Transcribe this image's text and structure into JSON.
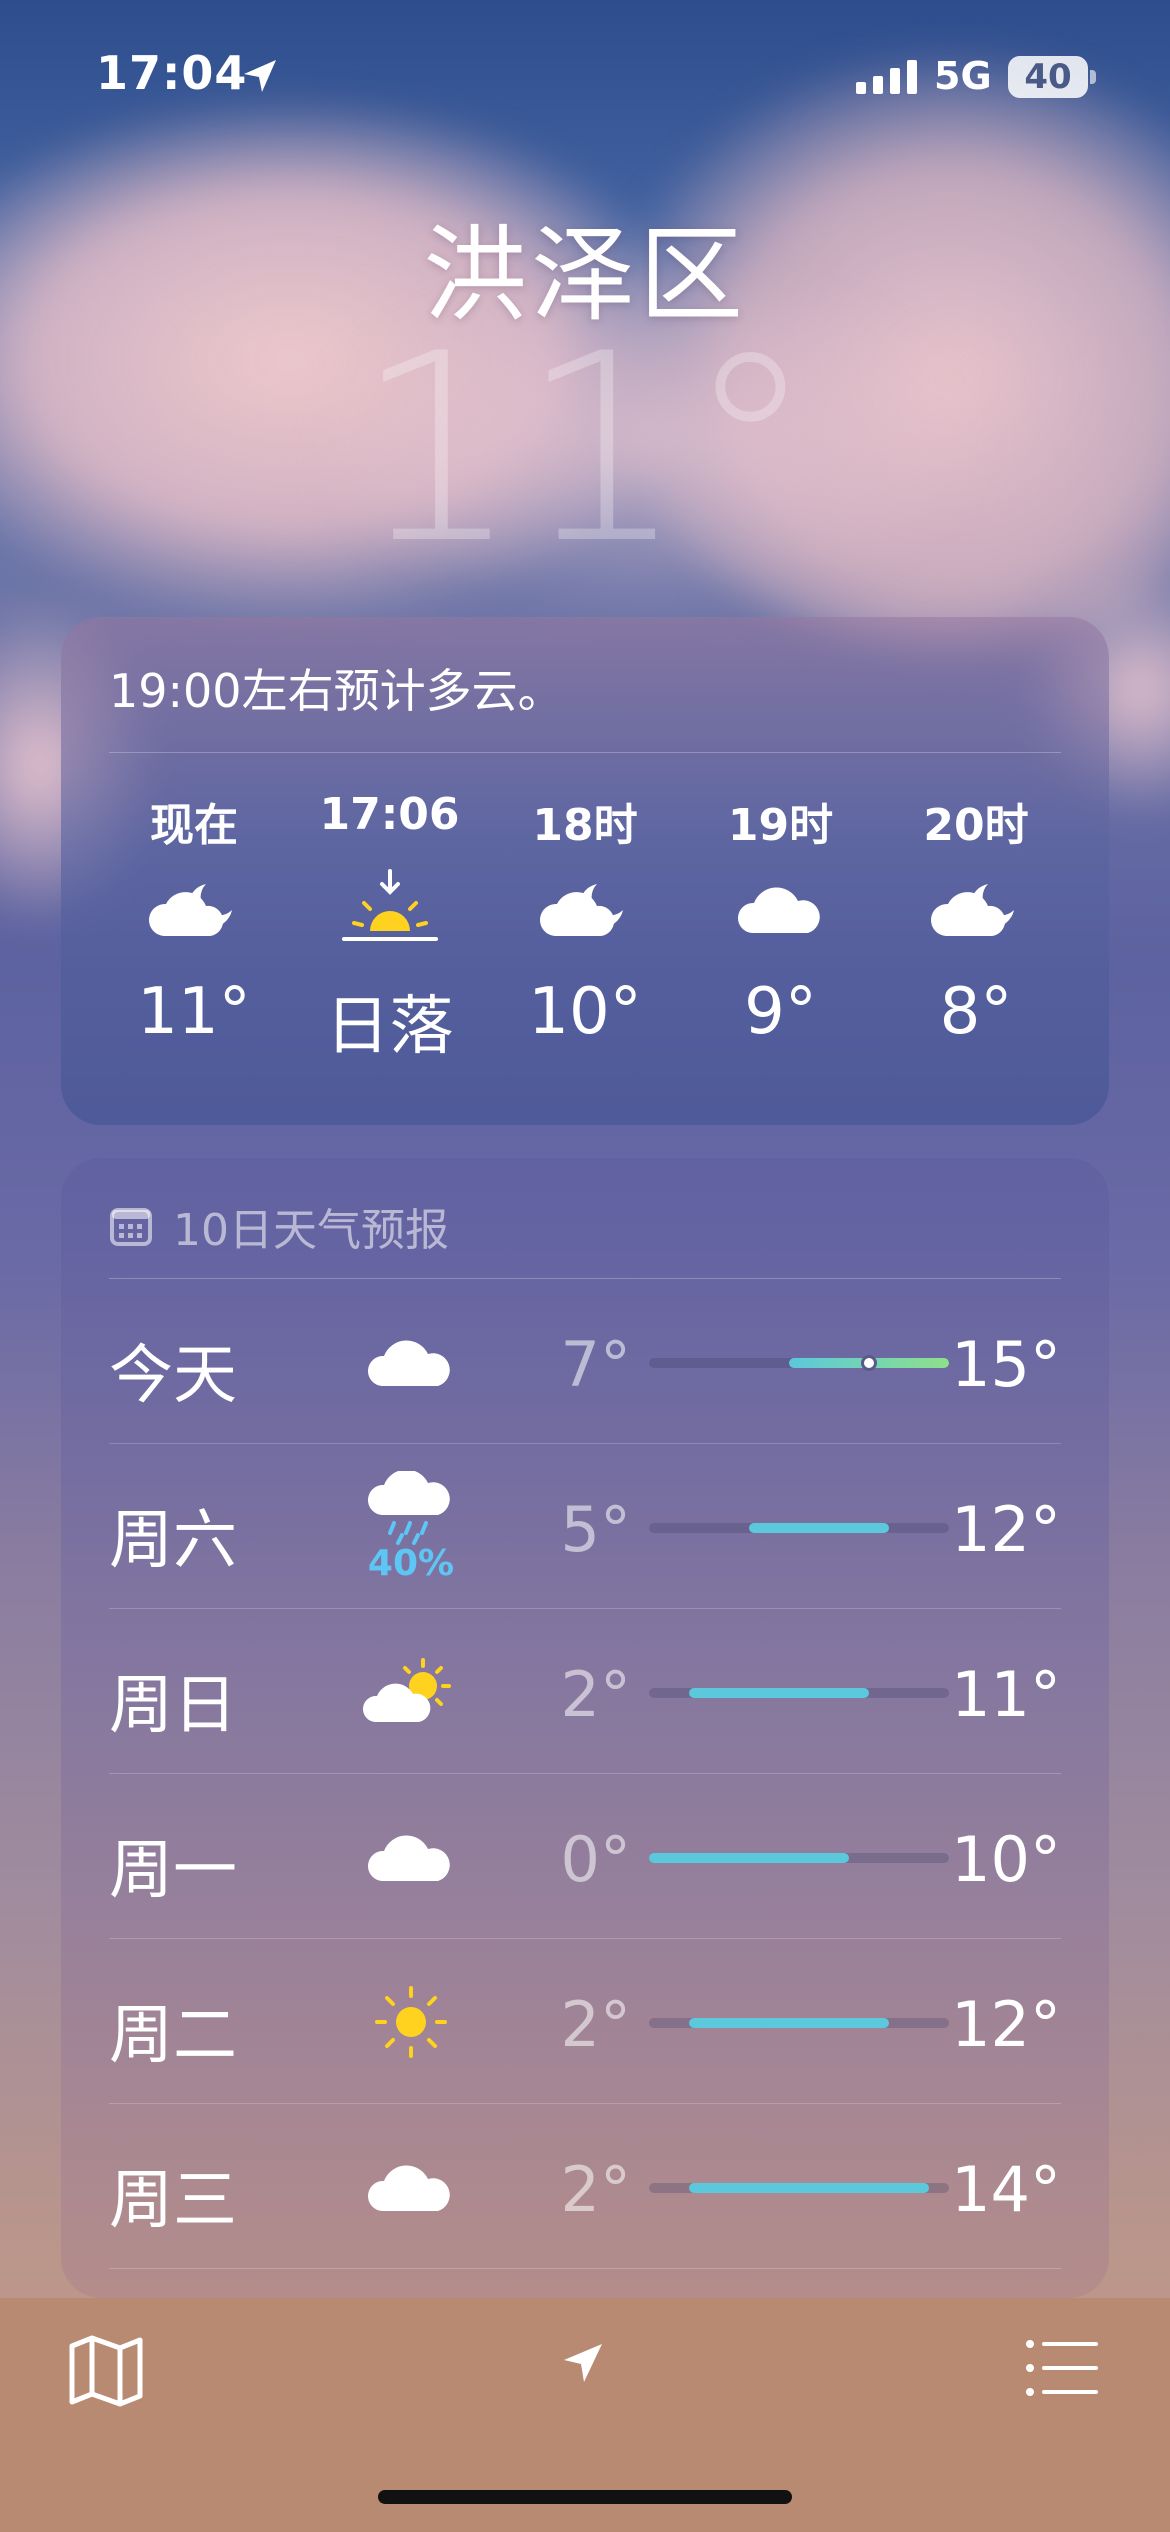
{
  "status_bar": {
    "time": "17:04",
    "network": "5G",
    "battery": "40"
  },
  "location": {
    "city": "洪泽区",
    "current_temp": "11°"
  },
  "hourly": {
    "summary": "19:00左右预计多云。",
    "items": [
      {
        "label": "现在",
        "icon": "partly-cloudy-night-icon",
        "value": "11°"
      },
      {
        "label": "17:06",
        "icon": "sunset-icon",
        "value": "日落"
      },
      {
        "label": "18时",
        "icon": "partly-cloudy-night-icon",
        "value": "10°"
      },
      {
        "label": "19时",
        "icon": "cloud-icon",
        "value": "9°"
      },
      {
        "label": "20时",
        "icon": "partly-cloudy-night-icon",
        "value": "8°"
      }
    ]
  },
  "daily": {
    "header": "10日天气预报",
    "range": [
      0,
      15
    ],
    "days": [
      {
        "day": "今天",
        "icon": "cloud-icon",
        "pop": "",
        "low": "7°",
        "high": "15°",
        "low_value": 7,
        "high_value": 15,
        "current_value": 11
      },
      {
        "day": "周六",
        "icon": "rain-cloud-icon",
        "pop": "40%",
        "low": "5°",
        "high": "12°",
        "low_value": 5,
        "high_value": 12
      },
      {
        "day": "周日",
        "icon": "partly-sunny-icon",
        "pop": "",
        "low": "2°",
        "high": "11°",
        "low_value": 2,
        "high_value": 11
      },
      {
        "day": "周一",
        "icon": "cloud-icon",
        "pop": "",
        "low": "0°",
        "high": "10°",
        "low_value": 0,
        "high_value": 10
      },
      {
        "day": "周二",
        "icon": "sun-icon",
        "pop": "",
        "low": "2°",
        "high": "12°",
        "low_value": 2,
        "high_value": 12
      },
      {
        "day": "周三",
        "icon": "cloud-icon",
        "pop": "",
        "low": "2°",
        "high": "14°",
        "low_value": 2,
        "high_value": 14
      }
    ]
  },
  "toolbar": {
    "left_icon": "map-icon",
    "center_icon": "location-arrow-icon",
    "right_icon": "list-icon"
  },
  "colors": {
    "precip": "#5ec6f5",
    "bar_cool": "#5bc8dc",
    "bar_warm": "#8ee08a",
    "sun": "#ffd21f",
    "toolbar_bg": "#b98a72"
  }
}
